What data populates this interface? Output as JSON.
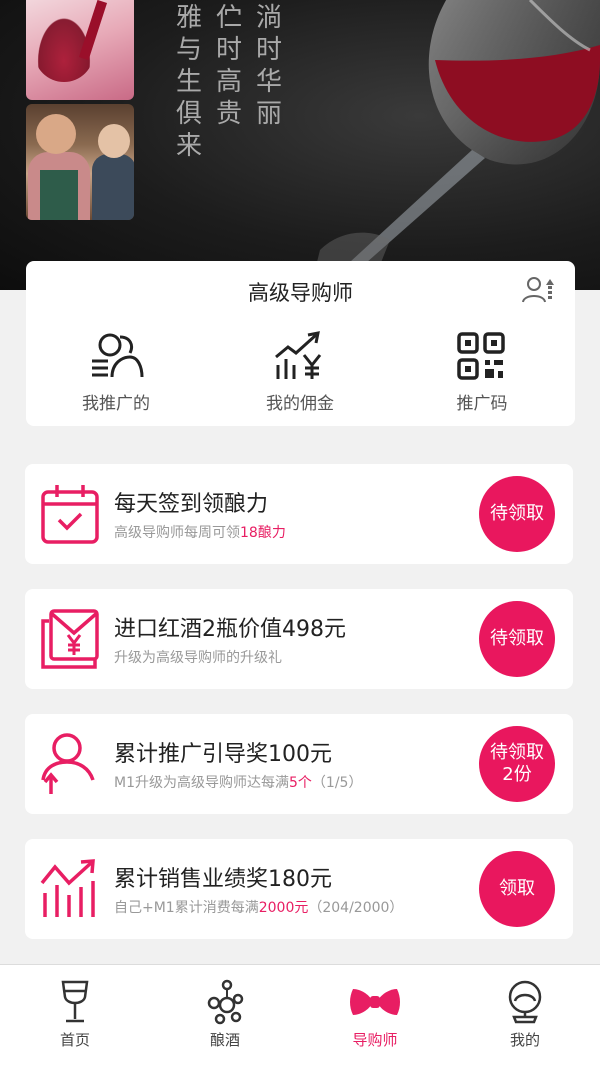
{
  "banner": {
    "poem_columns": [
      [
        "雅",
        "与",
        "生",
        "俱",
        "来"
      ],
      [
        "伫",
        "时",
        "高",
        "贵"
      ],
      [
        "淌",
        "时",
        "华",
        "丽"
      ]
    ]
  },
  "role_card": {
    "title": "高级导购师",
    "actions": [
      {
        "label": "我推广的",
        "icon": "people-list-icon"
      },
      {
        "label": "我的佣金",
        "icon": "yen-growth-chart-icon"
      },
      {
        "label": "推广码",
        "icon": "qr-code-icon"
      }
    ]
  },
  "tasks": [
    {
      "title": "每天签到领酿力",
      "subtitle_before": "高级导购师每周可领",
      "subtitle_highlight": "18酿力",
      "subtitle_after": "",
      "button_line1": "待领取",
      "button_line2": "",
      "icon": "calendar-check-icon"
    },
    {
      "title": "进口红酒2瓶价值498元",
      "subtitle_before": "升级为高级导购师的升级礼",
      "subtitle_highlight": "",
      "subtitle_after": "",
      "button_line1": "待领取",
      "button_line2": "",
      "icon": "red-envelope-yen-icon"
    },
    {
      "title": "累计推广引导奖100元",
      "subtitle_before": "M1升级为高级导购师达每满",
      "subtitle_highlight": "5个",
      "subtitle_after": "（1/5）",
      "button_line1": "待领取",
      "button_line2": "2份",
      "icon": "user-arrow-up-icon"
    },
    {
      "title": "累计销售业绩奖180元",
      "subtitle_before": "自己+M1累计消费每满",
      "subtitle_highlight": "2000元",
      "subtitle_after": "（204/2000）",
      "button_line1": "领取",
      "button_line2": "",
      "icon": "sales-growth-icon"
    }
  ],
  "tabbar": {
    "items": [
      {
        "label": "首页",
        "icon": "wine-glass-icon",
        "active": false
      },
      {
        "label": "酿酒",
        "icon": "grape-molecule-icon",
        "active": false
      },
      {
        "label": "导购师",
        "icon": "bow-tie-icon",
        "active": true
      },
      {
        "label": "我的",
        "icon": "profile-avatar-icon",
        "active": false
      }
    ]
  },
  "colors": {
    "accent": "#e81e63",
    "button": "#e9175e",
    "background": "#f1f1f1",
    "card": "#ffffff"
  }
}
